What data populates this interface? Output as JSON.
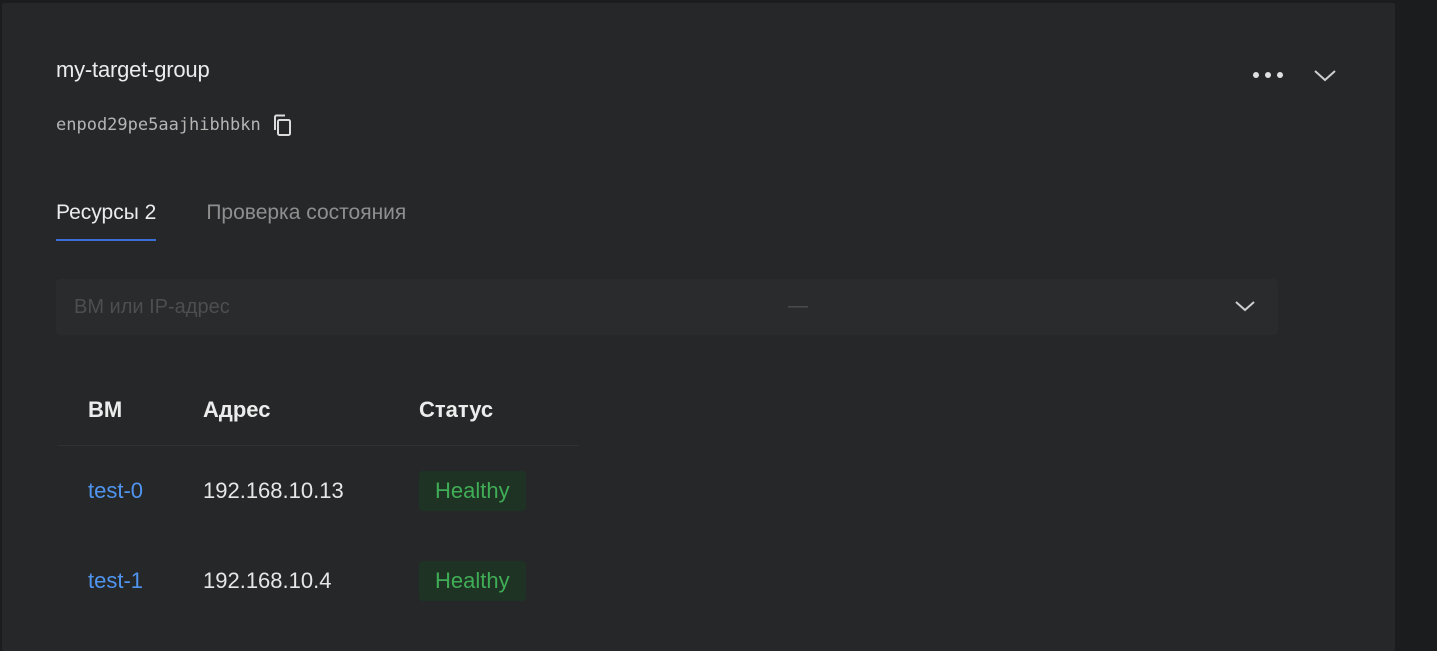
{
  "target_group": {
    "name": "my-target-group",
    "id": "enpod29pe5aajhibhbkn"
  },
  "header_actions": {
    "more_icon": "more-horizontal-icon",
    "collapse_icon": "chevron-down-icon"
  },
  "tabs": [
    {
      "label": "Ресурсы 2",
      "active": true
    },
    {
      "label": "Проверка состояния",
      "active": false
    }
  ],
  "filters": {
    "search_placeholder": "ВМ или IP-адрес",
    "status_value": "—"
  },
  "table": {
    "headers": [
      "ВМ",
      "Адрес",
      "Статус"
    ],
    "rows": [
      {
        "vm": "test-0",
        "address": "192.168.10.13",
        "status": "Healthy"
      },
      {
        "vm": "test-1",
        "address": "192.168.10.4",
        "status": "Healthy"
      }
    ]
  },
  "colors": {
    "link": "#4f95f0",
    "healthy_text": "#3fad55",
    "healthy_bg": "#1f3325",
    "tab_underline": "#3a6fd8",
    "card_bg": "#262728"
  }
}
